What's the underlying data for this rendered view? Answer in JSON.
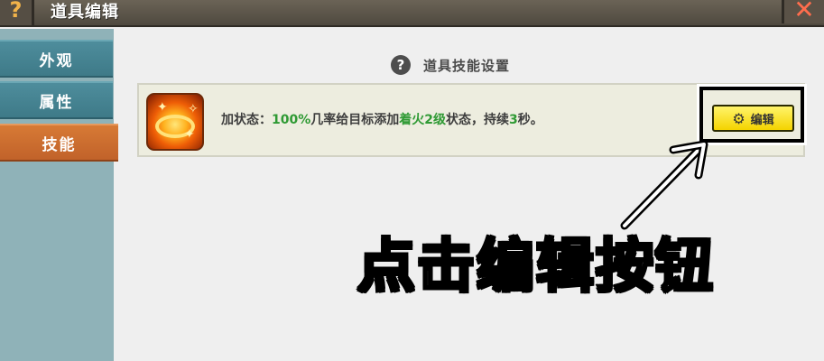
{
  "window": {
    "title": "道具编辑",
    "help_glyph": "?",
    "close_glyph": "✕"
  },
  "sidebar": {
    "items": [
      {
        "label": "外观",
        "active": false
      },
      {
        "label": "属性",
        "active": false
      },
      {
        "label": "技能",
        "active": true
      }
    ]
  },
  "section": {
    "icon": "question-icon",
    "icon_glyph": "?",
    "title": "道具技能设置"
  },
  "skill": {
    "icon": "fire-ring-icon",
    "desc_prefix": "加状态：",
    "desc_pct": "100%",
    "desc_mid1": "几率给目标添加",
    "desc_status": "着火2级",
    "desc_mid2": "状态，持续",
    "desc_secs": "3",
    "desc_suffix": "秒。",
    "edit_label": "编辑",
    "edit_icon": "gear-icon"
  },
  "annotation": {
    "text": "点击编辑按钮"
  },
  "colors": {
    "titlebar": "#5c554a",
    "sidebar_tab": "#4e8d9c",
    "sidebar_active": "#d77a35",
    "highlight_green": "#2f9a34",
    "edit_button": "#f4d300"
  }
}
